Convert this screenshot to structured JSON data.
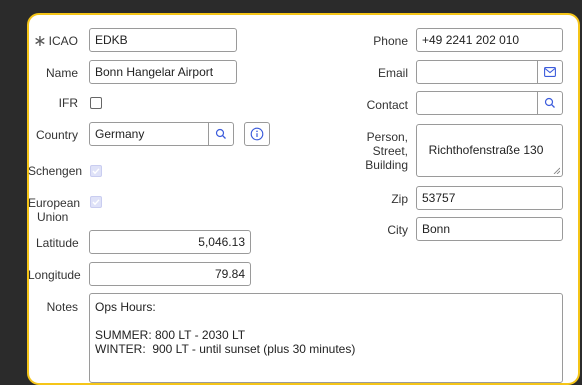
{
  "fields": {
    "icao": {
      "label": "ICAO",
      "value": "EDKB"
    },
    "name": {
      "label": "Name",
      "value": "Bonn Hangelar Airport"
    },
    "ifr": {
      "label": "IFR"
    },
    "country": {
      "label": "Country",
      "value": "Germany"
    },
    "schengen": {
      "label": "Schengen"
    },
    "eu": {
      "label_line1": "European",
      "label_line2": "Union"
    },
    "latitude": {
      "label": "Latitude",
      "value": "5,046.13"
    },
    "longitude": {
      "label": "Longitude",
      "value": "79.84"
    },
    "notes": {
      "label": "Notes",
      "value": "Ops Hours:\n\nSUMMER: 800 LT - 2030 LT\nWINTER:  900 LT - until sunset (plus 30 minutes)"
    },
    "phone": {
      "label": "Phone",
      "value": "+49 2241 202 010"
    },
    "email": {
      "label": "Email",
      "value": ""
    },
    "contact": {
      "label": "Contact",
      "value": ""
    },
    "street": {
      "label_line1": "Person,",
      "label_line2": "Street,",
      "label_line3": "Building",
      "value": "Richthofenstraße 130"
    },
    "zip": {
      "label": "Zip",
      "value": "53757"
    },
    "city": {
      "label": "City",
      "value": "Bonn"
    }
  },
  "icons": {
    "required": "asterisk-icon",
    "search": "search-icon",
    "info": "info-icon",
    "mail": "mail-icon"
  },
  "colors": {
    "accent": "#f5c518",
    "icon_blue": "#3b5bdb"
  }
}
